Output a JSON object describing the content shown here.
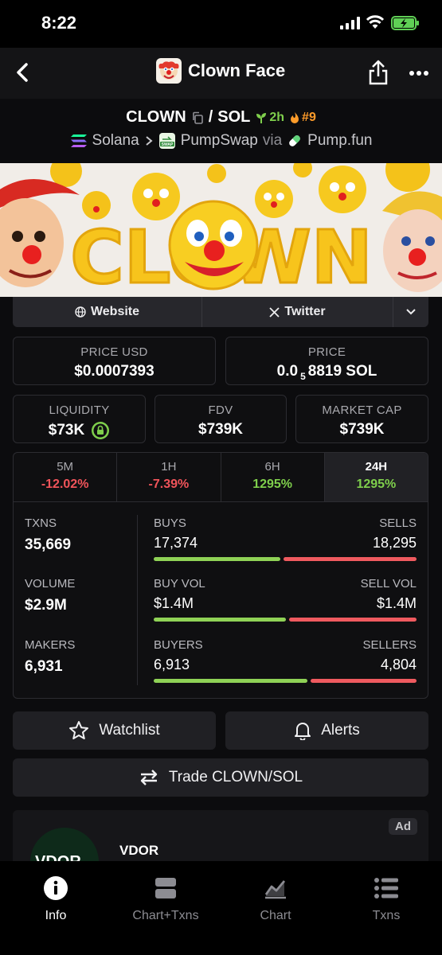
{
  "status_bar": {
    "time": "8:22"
  },
  "header": {
    "title": "Clown Face"
  },
  "pair": {
    "base": "CLOWN",
    "slash": "/",
    "quote": "SOL",
    "age": "2h",
    "rank": "#9",
    "chain": "Solana",
    "dex": "PumpSwap",
    "via": "via",
    "launchpad": "Pump.fun"
  },
  "banner": {
    "word": "CLOWN"
  },
  "links": {
    "website": "Website",
    "twitter": "Twitter"
  },
  "stats": {
    "price_usd_label": "PRICE USD",
    "price_usd": "$0.0007393",
    "price_label": "PRICE",
    "price_pre": "0.0",
    "price_sub": "5",
    "price_post": "8819 SOL",
    "liquidity_label": "LIQUIDITY",
    "liquidity": "$73K",
    "fdv_label": "FDV",
    "fdv": "$739K",
    "mcap_label": "MARKET CAP",
    "mcap": "$739K"
  },
  "timeframes": [
    {
      "label": "5M",
      "value": "-12.02%"
    },
    {
      "label": "1H",
      "value": "-7.39%"
    },
    {
      "label": "6H",
      "value": "1295%"
    },
    {
      "label": "24H",
      "value": "1295%"
    }
  ],
  "metrics": {
    "txns_label": "TXNS",
    "txns": "35,669",
    "volume_label": "VOLUME",
    "volume": "$2.9M",
    "makers_label": "MAKERS",
    "makers": "6,931",
    "buys_label": "BUYS",
    "buys": "17,374",
    "sells_label": "SELLS",
    "sells": "18,295",
    "buys_ratio": 0.487,
    "buyvol_label": "BUY VOL",
    "buyvol": "$1.4M",
    "sellvol_label": "SELL VOL",
    "sellvol": "$1.4M",
    "buyvol_ratio": 0.51,
    "buyers_label": "BUYERS",
    "buyers": "6,913",
    "sellers_label": "SELLERS",
    "sellers": "4,804",
    "buyers_ratio": 0.59
  },
  "actions": {
    "watchlist": "Watchlist",
    "alerts": "Alerts",
    "trade": "Trade CLOWN/SOL"
  },
  "ad": {
    "tag": "Ad",
    "name": "VDOR",
    "logo_text": "VDOR"
  },
  "nav": [
    {
      "label": "Info",
      "icon": "info-icon"
    },
    {
      "label": "Chart+Txns",
      "icon": "split-view-icon"
    },
    {
      "label": "Chart",
      "icon": "chart-icon"
    },
    {
      "label": "Txns",
      "icon": "list-icon"
    }
  ],
  "colors": {
    "green": "#7fcf4c",
    "red": "#f0545a",
    "orange": "#ff9c2a",
    "background": "#0c0c0e"
  }
}
